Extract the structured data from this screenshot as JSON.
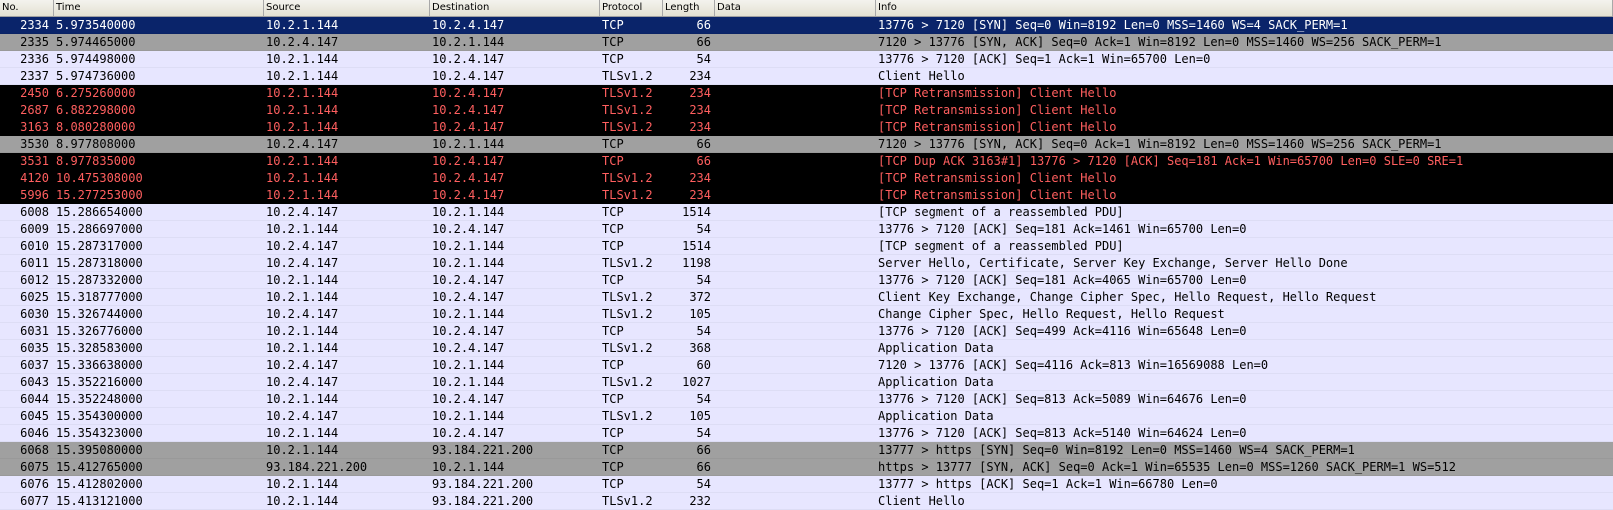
{
  "columns": {
    "no": "No.",
    "time": "Time",
    "source": "Source",
    "destination": "Destination",
    "protocol": "Protocol",
    "length": "Length",
    "data": "Data",
    "info": "Info"
  },
  "colors": {
    "selected_bg": "#0a246a",
    "tcp_bg": "#e7e6ff",
    "syn_bg": "#a0a0a0",
    "bad_bg": "#000000",
    "bad_fg": "#ff5f5f"
  },
  "packets": [
    {
      "no": "2334",
      "time": "5.973540000",
      "source": "10.2.1.144",
      "destination": "10.2.4.147",
      "protocol": "TCP",
      "length": "66",
      "data": "",
      "info": "13776 > 7120 [SYN] Seq=0 Win=8192 Len=0 MSS=1460 WS=4 SACK_PERM=1",
      "style": "selected"
    },
    {
      "no": "2335",
      "time": "5.974465000",
      "source": "10.2.4.147",
      "destination": "10.2.1.144",
      "protocol": "TCP",
      "length": "66",
      "data": "",
      "info": "7120 > 13776 [SYN, ACK] Seq=0 Ack=1 Win=8192 Len=0 MSS=1460 WS=256 SACK_PERM=1",
      "style": "syn"
    },
    {
      "no": "2336",
      "time": "5.974498000",
      "source": "10.2.1.144",
      "destination": "10.2.4.147",
      "protocol": "TCP",
      "length": "54",
      "data": "",
      "info": "13776 > 7120 [ACK] Seq=1 Ack=1 Win=65700 Len=0",
      "style": "tcp"
    },
    {
      "no": "2337",
      "time": "5.974736000",
      "source": "10.2.1.144",
      "destination": "10.2.4.147",
      "protocol": "TLSv1.2",
      "length": "234",
      "data": "",
      "info": "Client Hello",
      "style": "tcp"
    },
    {
      "no": "2450",
      "time": "6.275260000",
      "source": "10.2.1.144",
      "destination": "10.2.4.147",
      "protocol": "TLSv1.2",
      "length": "234",
      "data": "",
      "info": "[TCP Retransmission] Client Hello",
      "style": "bad"
    },
    {
      "no": "2687",
      "time": "6.882298000",
      "source": "10.2.1.144",
      "destination": "10.2.4.147",
      "protocol": "TLSv1.2",
      "length": "234",
      "data": "",
      "info": "[TCP Retransmission] Client Hello",
      "style": "bad"
    },
    {
      "no": "3163",
      "time": "8.080280000",
      "source": "10.2.1.144",
      "destination": "10.2.4.147",
      "protocol": "TLSv1.2",
      "length": "234",
      "data": "",
      "info": "[TCP Retransmission] Client Hello",
      "style": "bad"
    },
    {
      "no": "3530",
      "time": "8.977808000",
      "source": "10.2.4.147",
      "destination": "10.2.1.144",
      "protocol": "TCP",
      "length": "66",
      "data": "",
      "info": "7120 > 13776 [SYN, ACK] Seq=0 Ack=1 Win=8192 Len=0 MSS=1460 WS=256 SACK_PERM=1",
      "style": "syn"
    },
    {
      "no": "3531",
      "time": "8.977835000",
      "source": "10.2.1.144",
      "destination": "10.2.4.147",
      "protocol": "TCP",
      "length": "66",
      "data": "",
      "info": "[TCP Dup ACK 3163#1] 13776 > 7120 [ACK] Seq=181 Ack=1 Win=65700 Len=0 SLE=0 SRE=1",
      "style": "bad"
    },
    {
      "no": "4120",
      "time": "10.475308000",
      "source": "10.2.1.144",
      "destination": "10.2.4.147",
      "protocol": "TLSv1.2",
      "length": "234",
      "data": "",
      "info": "[TCP Retransmission] Client Hello",
      "style": "bad"
    },
    {
      "no": "5996",
      "time": "15.277253000",
      "source": "10.2.1.144",
      "destination": "10.2.4.147",
      "protocol": "TLSv1.2",
      "length": "234",
      "data": "",
      "info": "[TCP Retransmission] Client Hello",
      "style": "bad"
    },
    {
      "no": "6008",
      "time": "15.286654000",
      "source": "10.2.4.147",
      "destination": "10.2.1.144",
      "protocol": "TCP",
      "length": "1514",
      "data": "",
      "info": "[TCP segment of a reassembled PDU]",
      "style": "tcp"
    },
    {
      "no": "6009",
      "time": "15.286697000",
      "source": "10.2.1.144",
      "destination": "10.2.4.147",
      "protocol": "TCP",
      "length": "54",
      "data": "",
      "info": "13776 > 7120 [ACK] Seq=181 Ack=1461 Win=65700 Len=0",
      "style": "tcp"
    },
    {
      "no": "6010",
      "time": "15.287317000",
      "source": "10.2.4.147",
      "destination": "10.2.1.144",
      "protocol": "TCP",
      "length": "1514",
      "data": "",
      "info": "[TCP segment of a reassembled PDU]",
      "style": "tcp"
    },
    {
      "no": "6011",
      "time": "15.287318000",
      "source": "10.2.4.147",
      "destination": "10.2.1.144",
      "protocol": "TLSv1.2",
      "length": "1198",
      "data": "",
      "info": "Server Hello, Certificate, Server Key Exchange, Server Hello Done",
      "style": "tcp"
    },
    {
      "no": "6012",
      "time": "15.287332000",
      "source": "10.2.1.144",
      "destination": "10.2.4.147",
      "protocol": "TCP",
      "length": "54",
      "data": "",
      "info": "13776 > 7120 [ACK] Seq=181 Ack=4065 Win=65700 Len=0",
      "style": "tcp"
    },
    {
      "no": "6025",
      "time": "15.318777000",
      "source": "10.2.1.144",
      "destination": "10.2.4.147",
      "protocol": "TLSv1.2",
      "length": "372",
      "data": "",
      "info": "Client Key Exchange, Change Cipher Spec, Hello Request, Hello Request",
      "style": "tcp"
    },
    {
      "no": "6030",
      "time": "15.326744000",
      "source": "10.2.4.147",
      "destination": "10.2.1.144",
      "protocol": "TLSv1.2",
      "length": "105",
      "data": "",
      "info": "Change Cipher Spec, Hello Request, Hello Request",
      "style": "tcp"
    },
    {
      "no": "6031",
      "time": "15.326776000",
      "source": "10.2.1.144",
      "destination": "10.2.4.147",
      "protocol": "TCP",
      "length": "54",
      "data": "",
      "info": "13776 > 7120 [ACK] Seq=499 Ack=4116 Win=65648 Len=0",
      "style": "tcp"
    },
    {
      "no": "6035",
      "time": "15.328583000",
      "source": "10.2.1.144",
      "destination": "10.2.4.147",
      "protocol": "TLSv1.2",
      "length": "368",
      "data": "",
      "info": "Application Data",
      "style": "tcp"
    },
    {
      "no": "6037",
      "time": "15.336638000",
      "source": "10.2.4.147",
      "destination": "10.2.1.144",
      "protocol": "TCP",
      "length": "60",
      "data": "",
      "info": "7120 > 13776 [ACK] Seq=4116 Ack=813 Win=16569088 Len=0",
      "style": "tcp"
    },
    {
      "no": "6043",
      "time": "15.352216000",
      "source": "10.2.4.147",
      "destination": "10.2.1.144",
      "protocol": "TLSv1.2",
      "length": "1027",
      "data": "",
      "info": "Application Data",
      "style": "tcp"
    },
    {
      "no": "6044",
      "time": "15.352248000",
      "source": "10.2.1.144",
      "destination": "10.2.4.147",
      "protocol": "TCP",
      "length": "54",
      "data": "",
      "info": "13776 > 7120 [ACK] Seq=813 Ack=5089 Win=64676 Len=0",
      "style": "tcp"
    },
    {
      "no": "6045",
      "time": "15.354300000",
      "source": "10.2.4.147",
      "destination": "10.2.1.144",
      "protocol": "TLSv1.2",
      "length": "105",
      "data": "",
      "info": "Application Data",
      "style": "tcp"
    },
    {
      "no": "6046",
      "time": "15.354323000",
      "source": "10.2.1.144",
      "destination": "10.2.4.147",
      "protocol": "TCP",
      "length": "54",
      "data": "",
      "info": "13776 > 7120 [ACK] Seq=813 Ack=5140 Win=64624 Len=0",
      "style": "tcp"
    },
    {
      "no": "6068",
      "time": "15.395080000",
      "source": "10.2.1.144",
      "destination": "93.184.221.200",
      "protocol": "TCP",
      "length": "66",
      "data": "",
      "info": "13777 > https [SYN] Seq=0 Win=8192 Len=0 MSS=1460 WS=4 SACK_PERM=1",
      "style": "syn"
    },
    {
      "no": "6075",
      "time": "15.412765000",
      "source": "93.184.221.200",
      "destination": "10.2.1.144",
      "protocol": "TCP",
      "length": "66",
      "data": "",
      "info": "https > 13777 [SYN, ACK] Seq=0 Ack=1 Win=65535 Len=0 MSS=1260 SACK_PERM=1 WS=512",
      "style": "syn"
    },
    {
      "no": "6076",
      "time": "15.412802000",
      "source": "10.2.1.144",
      "destination": "93.184.221.200",
      "protocol": "TCP",
      "length": "54",
      "data": "",
      "info": "13777 > https [ACK] Seq=1 Ack=1 Win=66780 Len=0",
      "style": "tcp"
    },
    {
      "no": "6077",
      "time": "15.413121000",
      "source": "10.2.1.144",
      "destination": "93.184.221.200",
      "protocol": "TLSv1.2",
      "length": "232",
      "data": "",
      "info": "Client Hello",
      "style": "tcp"
    }
  ]
}
